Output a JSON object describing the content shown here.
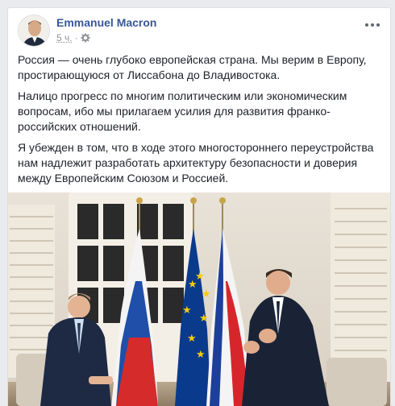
{
  "post": {
    "author": "Emmanuel Macron",
    "time": "5 ч.",
    "audience_icon": "gear-icon",
    "more_icon": "more-dots-icon",
    "paragraphs": [
      "Россия — очень глубоко европейская страна. Мы верим в Европу, простирающуюся от Лиссабона до Владивостока.",
      "Налицо прогресс по многим политическим или экономическим вопросам, ибо мы прилагаем усилия для развития франко-российских отношений.",
      "Я убежден в том, что в ходе этого многостороннего переустройства нам надлежит разработать архитектуру безопасности и доверия между Европейским Союзом и Россией."
    ]
  },
  "colors": {
    "author_link": "#385898",
    "meta": "#90949c",
    "page_bg": "#e9ebee",
    "flag_blue": "#1c3f9a",
    "flag_red": "#d7262b",
    "eu_blue": "#0a3a8c",
    "eu_star": "#f5cc0a"
  }
}
